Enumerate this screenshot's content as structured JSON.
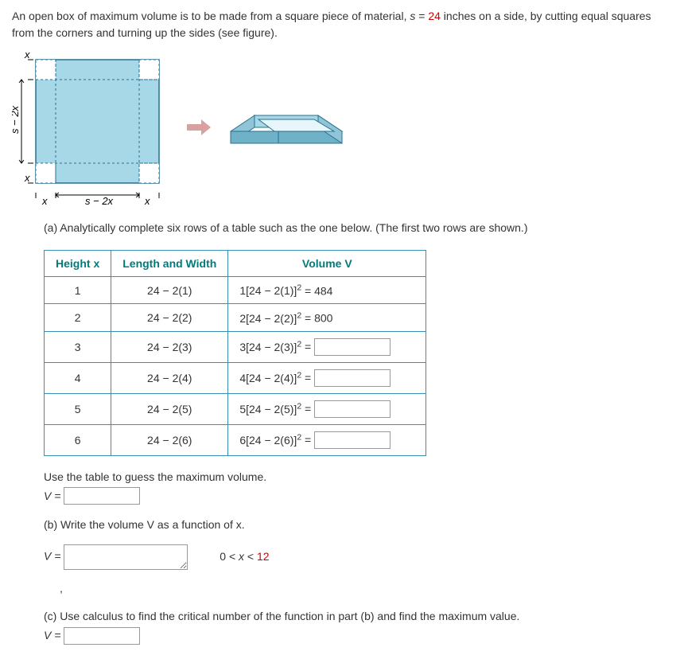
{
  "intro": {
    "part1": "An open box of maximum volume is to be made from a square piece of material, ",
    "s_eq": "s",
    "eq_sign": " = ",
    "s_val": "24",
    "part2": " inches on a side, by cutting equal squares from the corners and turning up the sides (see figure)."
  },
  "fig_labels": {
    "x": "x",
    "s2x_h": "s − 2x",
    "s2x_v": "s − 2x"
  },
  "part_a": "(a) Analytically complete six rows of a table such as the one below. (The first two rows are shown.)",
  "table": {
    "headers": {
      "h": "Height x",
      "lw": "Length and Width",
      "v": "Volume V"
    },
    "rows": [
      {
        "h": "1",
        "lw": "24 − 2(1)",
        "vexpr": "1[24 − 2(1)]",
        "vresult": " = 484",
        "has_input": false
      },
      {
        "h": "2",
        "lw": "24 − 2(2)",
        "vexpr": "2[24 − 2(2)]",
        "vresult": " = 800",
        "has_input": false
      },
      {
        "h": "3",
        "lw": "24 − 2(3)",
        "vexpr": "3[24 − 2(3)]",
        "veq": " = ",
        "has_input": true
      },
      {
        "h": "4",
        "lw": "24 − 2(4)",
        "vexpr": "4[24 − 2(4)]",
        "veq": " = ",
        "has_input": true
      },
      {
        "h": "5",
        "lw": "24 − 2(5)",
        "vexpr": "5[24 − 2(5)]",
        "veq": " = ",
        "has_input": true
      },
      {
        "h": "6",
        "lw": "24 − 2(6)",
        "vexpr": "6[24 − 2(6)]",
        "veq": " = ",
        "has_input": true
      }
    ]
  },
  "guess": {
    "text": "Use the table to guess the maximum volume.",
    "label": "V = "
  },
  "part_b": {
    "text": "(b) Write the volume V as a function of x.",
    "label": "V = ",
    "domain_pre": "0 < ",
    "domain_x": "x",
    "domain_post": " < ",
    "domain_val": "12"
  },
  "part_c": {
    "text": "(c) Use calculus to find the critical number of the function in part (b) and find the maximum value.",
    "label": "V = "
  }
}
